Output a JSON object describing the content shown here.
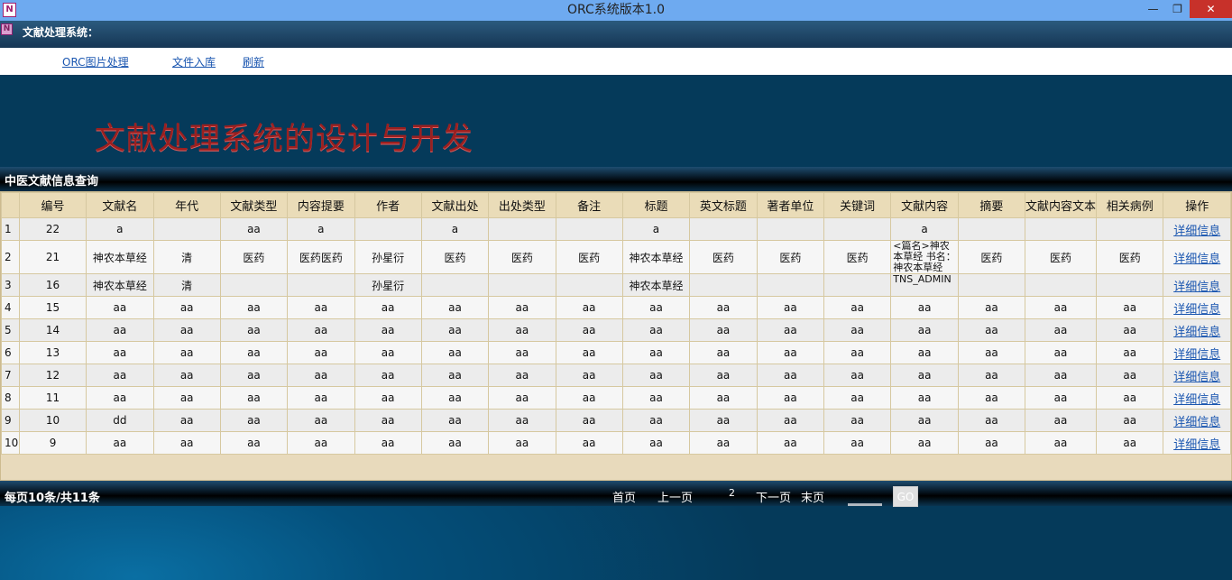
{
  "window": {
    "title": "ORC系统版本1.0",
    "app_icon": "N",
    "minimize": "—",
    "maximize": "❐",
    "close": "✕"
  },
  "menu": {
    "title": "文献处理系统："
  },
  "nav": {
    "links": [
      "ORC图片处理",
      "文件入库",
      "刷新"
    ]
  },
  "banner": {
    "title": "文献处理系统的设计与开发"
  },
  "section": {
    "title": "中医文献信息查询"
  },
  "table": {
    "headers": [
      "编号",
      "文献名",
      "年代",
      "文献类型",
      "内容提要",
      "作者",
      "文献出处",
      "出处类型",
      "备注",
      "标题",
      "英文标题",
      "著者单位",
      "关键词",
      "文献内容",
      "摘要",
      "文献内容文本",
      "相关病例",
      "操作"
    ],
    "action_label": "详细信息",
    "rows": [
      [
        "1",
        "22",
        "a",
        "",
        "aa",
        "a",
        "",
        "a",
        "",
        "",
        "a",
        "",
        "",
        "",
        "a",
        "",
        "",
        ""
      ],
      [
        "2",
        "21",
        "神农本草经",
        "清",
        "医药",
        "医药医药",
        "孙星衍",
        "医药",
        "医药",
        "医药",
        "神农本草经",
        "医药",
        "医药",
        "医药",
        "<篇名>神农本草经 书名：神农本草经",
        "医药",
        "医药",
        "医药"
      ],
      [
        "3",
        "16",
        "神农本草经",
        "清",
        "",
        "",
        "孙星衍",
        "",
        "",
        "",
        "神农本草经",
        "",
        "",
        "",
        "TNS_ADMIN",
        "",
        "",
        ""
      ],
      [
        "4",
        "15",
        "aa",
        "aa",
        "aa",
        "aa",
        "aa",
        "aa",
        "aa",
        "aa",
        "aa",
        "aa",
        "aa",
        "aa",
        "aa",
        "aa",
        "aa",
        "aa"
      ],
      [
        "5",
        "14",
        "aa",
        "aa",
        "aa",
        "aa",
        "aa",
        "aa",
        "aa",
        "aa",
        "aa",
        "aa",
        "aa",
        "aa",
        "aa",
        "aa",
        "aa",
        "aa"
      ],
      [
        "6",
        "13",
        "aa",
        "aa",
        "aa",
        "aa",
        "aa",
        "aa",
        "aa",
        "aa",
        "aa",
        "aa",
        "aa",
        "aa",
        "aa",
        "aa",
        "aa",
        "aa"
      ],
      [
        "7",
        "12",
        "aa",
        "aa",
        "aa",
        "aa",
        "aa",
        "aa",
        "aa",
        "aa",
        "aa",
        "aa",
        "aa",
        "aa",
        "aa",
        "aa",
        "aa",
        "aa"
      ],
      [
        "8",
        "11",
        "aa",
        "aa",
        "aa",
        "aa",
        "aa",
        "aa",
        "aa",
        "aa",
        "aa",
        "aa",
        "aa",
        "aa",
        "aa",
        "aa",
        "aa",
        "aa"
      ],
      [
        "9",
        "10",
        "dd",
        "aa",
        "aa",
        "aa",
        "aa",
        "aa",
        "aa",
        "aa",
        "aa",
        "aa",
        "aa",
        "aa",
        "aa",
        "aa",
        "aa",
        "aa"
      ],
      [
        "10",
        "9",
        "aa",
        "aa",
        "aa",
        "aa",
        "aa",
        "aa",
        "aa",
        "aa",
        "aa",
        "aa",
        "aa",
        "aa",
        "aa",
        "aa",
        "aa",
        "aa"
      ]
    ]
  },
  "footer": {
    "summary": "每页10条/共11条",
    "first": "首页",
    "prev": "上一页",
    "current_page": "2",
    "next": "下一页",
    "last": "末页",
    "go": "GO",
    "page_input": ""
  }
}
